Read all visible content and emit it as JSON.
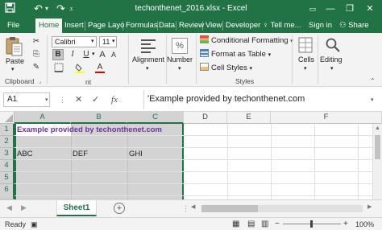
{
  "window": {
    "title": "techonthenet_2016.xlsx - Excel",
    "app_icon": "excel-save-icon",
    "minimize": "—",
    "restore": "❐",
    "close": "✕",
    "ribbon_opts": "▭"
  },
  "tabs": [
    "File",
    "Home",
    "Insert",
    "Page Layo",
    "Formulas",
    "Data",
    "Review",
    "View",
    "Developer"
  ],
  "active_tab": "Home",
  "tell_me": "Tell me...",
  "sign_in": "Sign in",
  "share": "Share",
  "ribbon": {
    "clipboard": {
      "paste": "Paste",
      "label": "Clipboard"
    },
    "font": {
      "name": "Calibri",
      "size": "11",
      "bold": "B",
      "italic": "I",
      "underline": "U",
      "grow": "A",
      "shrink": "A",
      "font_color": "A"
    },
    "alignment": "Alignment",
    "number": "Number",
    "styles": {
      "conditional": "Conditional Formatting",
      "format_table": "Format as Table",
      "cell_styles": "Cell Styles",
      "label": "Styles"
    },
    "cells": "Cells",
    "editing": "Editing"
  },
  "formula_bar": {
    "name_box": "A1",
    "cancel": "✕",
    "enter": "✓",
    "fx": "fx",
    "content": "'Example provided by techonthenet.com"
  },
  "grid": {
    "columns": [
      "A",
      "B",
      "C",
      "D",
      "E",
      "F"
    ],
    "rows": [
      "1",
      "2",
      "3",
      "4",
      "5",
      "6"
    ],
    "cells": {
      "A1": "Example provided by techonthenet.com",
      "A3": "ABC",
      "B3": "DEF",
      "C3": "GHI"
    },
    "title_color": "#7030a0",
    "selection_color": "#217346"
  },
  "sheet": {
    "name": "Sheet1",
    "add": "+"
  },
  "status": {
    "ready": "Ready",
    "zoom": "100%",
    "zoom_minus": "−",
    "zoom_plus": "+"
  },
  "colors": {
    "accent": "#217346",
    "ribbon_bg": "#f3f3f3"
  }
}
